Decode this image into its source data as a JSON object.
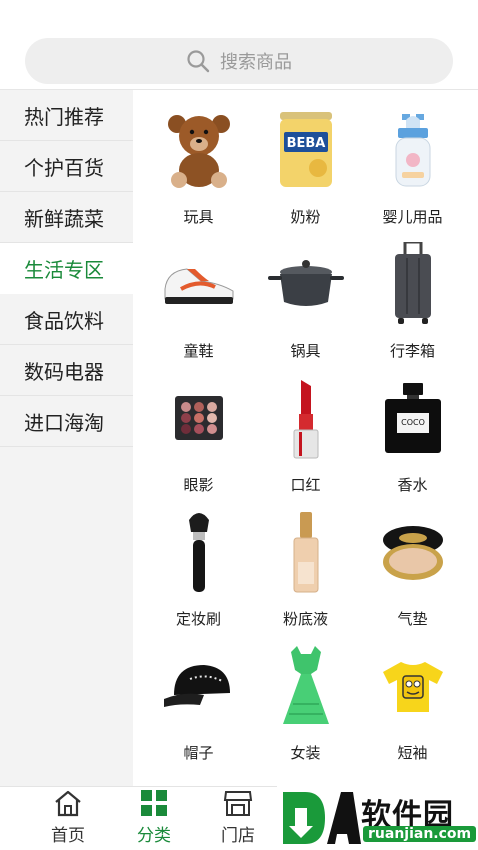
{
  "search": {
    "placeholder": "搜索商品",
    "icon": "search-icon"
  },
  "sidebar": {
    "items": [
      {
        "label": "热门推荐"
      },
      {
        "label": "个护百货"
      },
      {
        "label": "新鲜蔬菜"
      },
      {
        "label": "生活专区",
        "active": true
      },
      {
        "label": "食品饮料"
      },
      {
        "label": "数码电器"
      },
      {
        "label": "进口海淘"
      }
    ]
  },
  "products": [
    {
      "label": "玩具",
      "icon": "teddy-bear-icon"
    },
    {
      "label": "奶粉",
      "icon": "milk-powder-can-icon",
      "brand": "BEBA"
    },
    {
      "label": "婴儿用品",
      "icon": "baby-bottle-icon"
    },
    {
      "label": "童鞋",
      "icon": "sneaker-icon"
    },
    {
      "label": "锅具",
      "icon": "pot-icon"
    },
    {
      "label": "行李箱",
      "icon": "suitcase-icon"
    },
    {
      "label": "眼影",
      "icon": "eyeshadow-palette-icon"
    },
    {
      "label": "口红",
      "icon": "lipstick-icon"
    },
    {
      "label": "香水",
      "icon": "perfume-bottle-icon",
      "brand": "COCO"
    },
    {
      "label": "定妆刷",
      "icon": "makeup-brush-icon"
    },
    {
      "label": "粉底液",
      "icon": "foundation-bottle-icon"
    },
    {
      "label": "气垫",
      "icon": "cushion-compact-icon"
    },
    {
      "label": "帽子",
      "icon": "cap-icon"
    },
    {
      "label": "女装",
      "icon": "green-dress-icon"
    },
    {
      "label": "短袖",
      "icon": "yellow-tshirt-icon"
    }
  ],
  "tabbar": {
    "home_label": "首页",
    "category_label": "分类",
    "store_label": "门店"
  },
  "watermark": {
    "text": "软件园",
    "url": "ruanjian.com",
    "letters": "DA"
  },
  "colors": {
    "accent": "#1a8a3a",
    "sidebar_bg": "#f3f3f3",
    "search_bg": "#eeeeee"
  }
}
